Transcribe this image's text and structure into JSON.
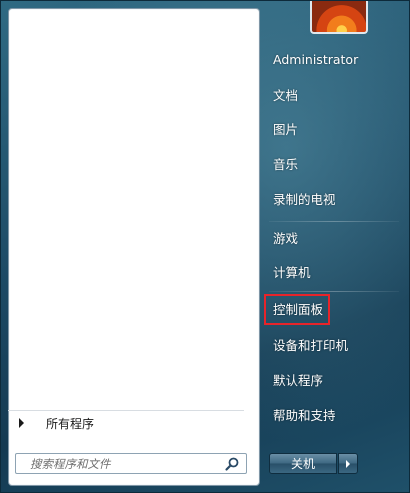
{
  "left_pane": {
    "all_programs_label": "所有程序",
    "search_placeholder": "搜索程序和文件"
  },
  "right_pane": {
    "items": [
      {
        "label": "Administrator"
      },
      {
        "label": "文档"
      },
      {
        "label": "图片"
      },
      {
        "label": "音乐"
      },
      {
        "label": "录制的电视"
      },
      {
        "label": "游戏"
      },
      {
        "label": "计算机"
      },
      {
        "label": "控制面板"
      },
      {
        "label": "设备和打印机"
      },
      {
        "label": "默认程序"
      },
      {
        "label": "帮助和支持"
      }
    ],
    "highlighted_item": "控制面板",
    "highlight_color": "#e8242a"
  },
  "shutdown": {
    "label": "关机"
  },
  "icons": {
    "all_programs": "arrow-right-icon",
    "search": "search-icon",
    "shutdown_options": "arrow-right-icon"
  }
}
